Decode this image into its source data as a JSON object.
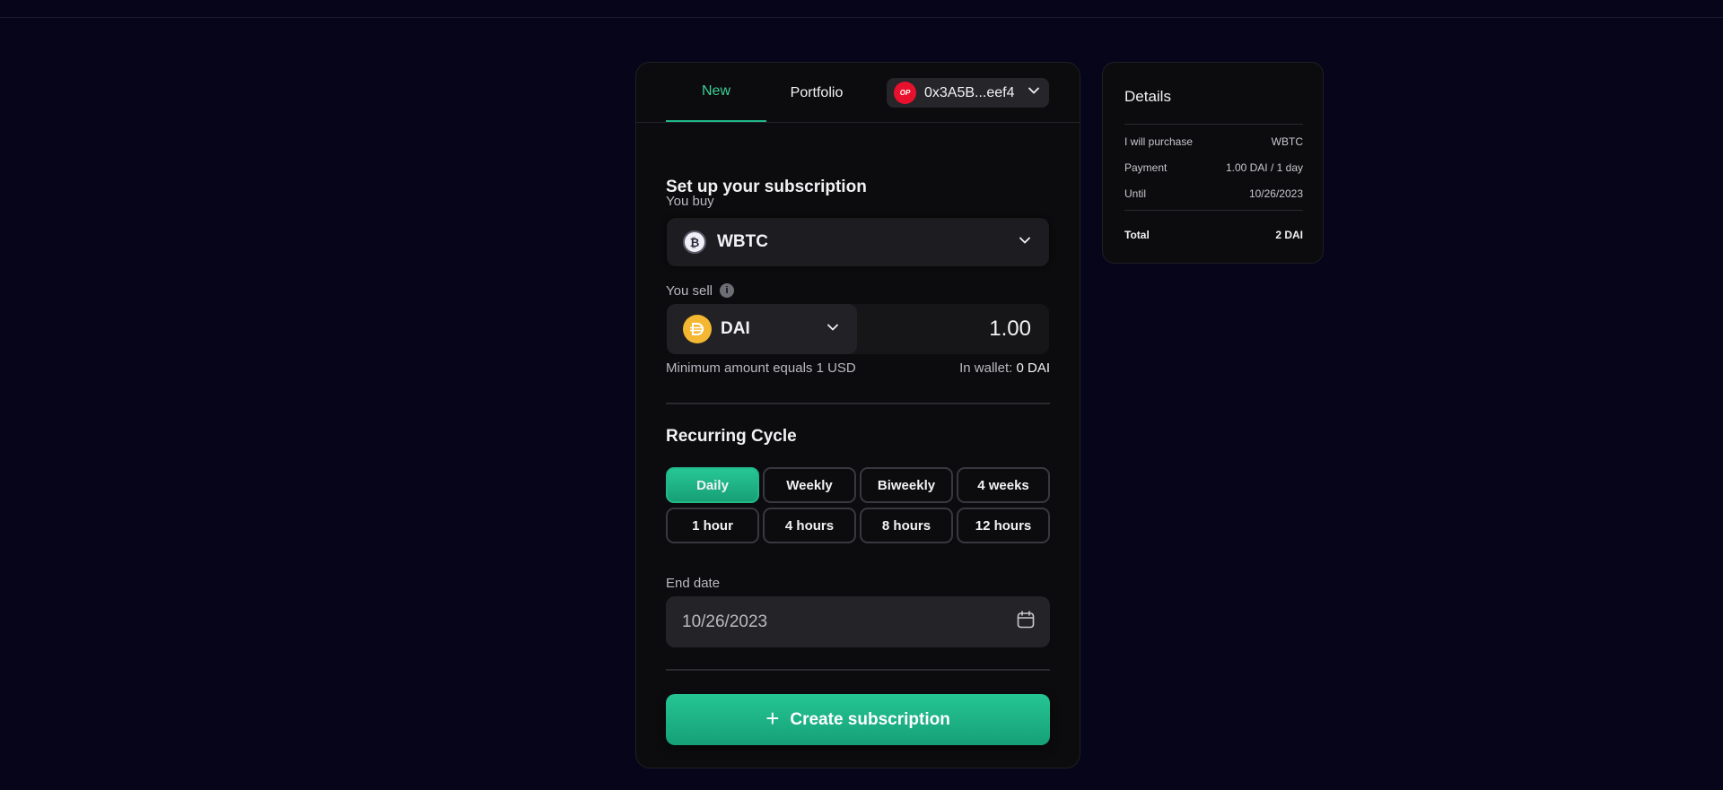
{
  "tabs": {
    "new_label": "New",
    "portfolio_label": "Portfolio"
  },
  "wallet": {
    "network_badge": "OP",
    "address": "0x3A5B...eef4"
  },
  "form": {
    "title": "Set up your subscription",
    "buy_label": "You buy",
    "buy_token": "WBTC",
    "sell_label": "You sell",
    "sell_token": "DAI",
    "sell_amount": "1.00",
    "min_amount_hint": "Minimum amount equals 1 USD",
    "wallet_hint_label": "In wallet:",
    "wallet_hint_value": "0 DAI"
  },
  "cycle": {
    "title": "Recurring Cycle",
    "options": [
      "Daily",
      "Weekly",
      "Biweekly",
      "4 weeks",
      "1 hour",
      "4 hours",
      "8 hours",
      "12 hours"
    ],
    "selected": "Daily"
  },
  "end_date": {
    "label": "End date",
    "value": "10/26/2023"
  },
  "create_button": {
    "label": "Create subscription"
  },
  "details": {
    "title": "Details",
    "purchase_label": "I will purchase",
    "purchase_value": "WBTC",
    "payment_label": "Payment",
    "payment_value": "1.00 DAI / 1 day",
    "until_label": "Until",
    "until_value": "10/26/2023",
    "total_label": "Total",
    "total_value": "2 DAI"
  },
  "colors": {
    "accent": "#1fb785",
    "background": "#06051a",
    "card": "#0c0c0e",
    "op_red": "#e8112d",
    "dai_yellow": "#f4b731"
  }
}
